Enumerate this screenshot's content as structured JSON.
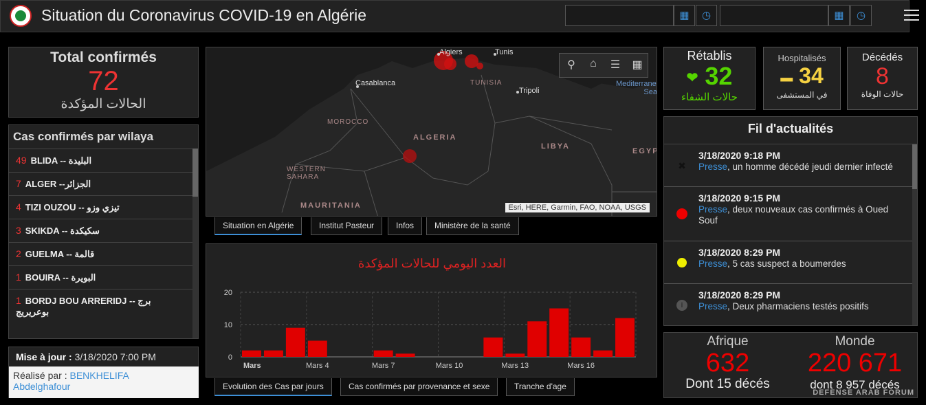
{
  "header": {
    "title": "Situation du Coronavirus COVID-19 en Algérie"
  },
  "total": {
    "title": "Total confirmés",
    "value": "72",
    "subtitle": "الحالات المؤكدة"
  },
  "wilaya": {
    "title": "Cas confirmés par wilaya",
    "items": [
      {
        "count": "49",
        "name": "BLIDA -- البليدة"
      },
      {
        "count": "7",
        "name": "ALGER --الجزائر"
      },
      {
        "count": "4",
        "name": "TIZI OUZOU -- تيزي وزو"
      },
      {
        "count": "3",
        "name": "SKIKDA -- سكيكدة"
      },
      {
        "count": "2",
        "name": "GUELMA -- قالمة"
      },
      {
        "count": "1",
        "name": "BOUIRA -- البويرة"
      },
      {
        "count": "1",
        "name": "BORDJ BOU ARRERIDJ -- برج بوعريريج"
      }
    ]
  },
  "updated": {
    "label": "Mise à jour :",
    "value": "3/18/2020 7:00 PM",
    "author_label": "Réalisé par :",
    "author_name": "BENKHELIFA",
    "author_name2": "Abdelghafour"
  },
  "map": {
    "labels": [
      "Algiers",
      "Tunis",
      "TUNISIA",
      "Casablanca",
      "Tripoli",
      "Mediterranean Sea",
      "MOROCCO",
      "ALGERIA",
      "LIBYA",
      "EGYPT",
      "WESTERN SAHARA",
      "MAURITANIA"
    ],
    "attribution": "Esri, HERE, Garmin, FAO, NOAA, USGS"
  },
  "map_tabs": [
    "Situation en Algérie",
    "Institut Pasteur",
    "Infos",
    "Ministère de la santé"
  ],
  "chart_tabs": [
    "Evolution des Cas par jours",
    "Cas confirmés par provenance et sexe",
    "Tranche d'age"
  ],
  "chart_data": {
    "type": "bar",
    "title": "العدد اليومي للحالات المؤكدة",
    "x_tick_labels": [
      "Mars",
      "Mars 4",
      "Mars 7",
      "Mars 10",
      "Mars 13",
      "Mars 16"
    ],
    "y_ticks": [
      0,
      10,
      20
    ],
    "ylim": [
      0,
      20
    ],
    "color": "#e00000",
    "values": [
      2,
      2,
      9,
      5,
      0,
      0,
      2,
      1,
      0,
      0,
      0,
      6,
      1,
      11,
      15,
      6,
      2,
      12
    ],
    "grid": true
  },
  "recovered": {
    "title": "Rétablis",
    "value": "32",
    "subtitle": "حالات الشفاء",
    "color": "#55d400"
  },
  "hospitalized": {
    "title": "Hospitalisés",
    "value": "34",
    "subtitle": "في المستشفى",
    "color": "#f5d142"
  },
  "deaths": {
    "title": "Décédés",
    "value": "8",
    "subtitle": "حالات الوفاة",
    "color": "#e33333"
  },
  "news": {
    "title": "Fil d'actualités",
    "items": [
      {
        "time": "3/18/2020 9:18 PM",
        "source": "Presse",
        "text": ", un homme décédé jeudi dernier infecté",
        "marker": "x"
      },
      {
        "time": "3/18/2020 9:15 PM",
        "source": "Presse",
        "text": ", deux nouveaux cas confirmés à Oued Souf",
        "marker": "red"
      },
      {
        "time": "3/18/2020 8:29 PM",
        "source": "Presse",
        "text": ", 5 cas suspect a boumerdes",
        "marker": "yellow"
      },
      {
        "time": "3/18/2020 8:29 PM",
        "source": "Presse",
        "text": ", Deux pharmaciens testés positifs",
        "marker": "info"
      }
    ]
  },
  "afrique": {
    "title": "Afrique",
    "value": "632",
    "subtitle": "Dont 15 décés"
  },
  "monde": {
    "title": "Monde",
    "value": "220 671",
    "subtitle": "dont 8 957 décés"
  },
  "watermark": {
    "text": "DEFENSE ARAB FORUM"
  }
}
